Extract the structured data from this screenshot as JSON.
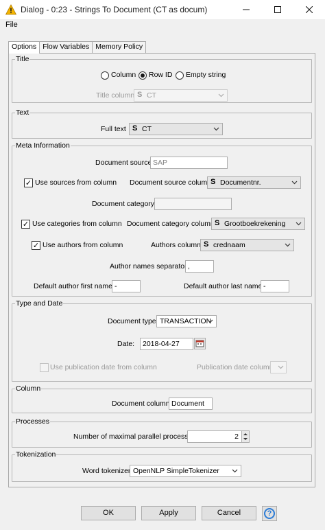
{
  "window": {
    "title": "Dialog - 0:23 - Strings To Document (CT as docum)",
    "icon": "warning-triangle-icon"
  },
  "menu": {
    "file": "File"
  },
  "tabs": [
    "Options",
    "Flow Variables",
    "Memory Policy"
  ],
  "title_group": {
    "legend": "Title",
    "radio_column": "Column",
    "radio_rowid": "Row ID",
    "radio_empty": "Empty string",
    "title_column_label": "Title column",
    "title_column_value": "CT"
  },
  "text_group": {
    "legend": "Text",
    "full_text_label": "Full text",
    "full_text_value": "CT"
  },
  "meta_group": {
    "legend": "Meta Information",
    "doc_source_label": "Document source",
    "doc_source_value": "SAP",
    "use_sources_label": "Use sources from column",
    "doc_source_col_label": "Document source column",
    "doc_source_col_value": "Documentnr.",
    "doc_category_label": "Document category",
    "doc_category_value": "",
    "use_categories_label": "Use categories from column",
    "doc_category_col_label": "Document category column",
    "doc_category_col_value": "Grootboekrekening",
    "use_authors_label": "Use authors from column",
    "authors_col_label": "Authors column",
    "authors_col_value": "crednaam",
    "author_sep_label": "Author names separator",
    "author_sep_value": ",",
    "default_first_label": "Default author first name",
    "default_first_value": "-",
    "default_last_label": "Default author last name",
    "default_last_value": "-"
  },
  "type_group": {
    "legend": "Type and Date",
    "doc_type_label": "Document type",
    "doc_type_value": "TRANSACTION",
    "date_label": "Date:",
    "date_value": "2018-04-27",
    "use_pub_date_label": "Use publication date from column",
    "pub_date_col_label": "Publication date column",
    "pub_date_col_value": ""
  },
  "column_group": {
    "legend": "Column",
    "doc_column_label": "Document column:",
    "doc_column_value": "Document"
  },
  "processes_group": {
    "legend": "Processes",
    "max_parallel_label": "Number of maximal parallel processes",
    "max_parallel_value": "2"
  },
  "tokenization_group": {
    "legend": "Tokenization",
    "word_tokenizer_label": "Word tokenizer",
    "word_tokenizer_value": "OpenNLP SimpleTokenizer"
  },
  "buttons": {
    "ok": "OK",
    "apply": "Apply",
    "cancel": "Cancel"
  },
  "colors": {
    "accent": "#2a7bd6",
    "warning": "#f4b400"
  }
}
